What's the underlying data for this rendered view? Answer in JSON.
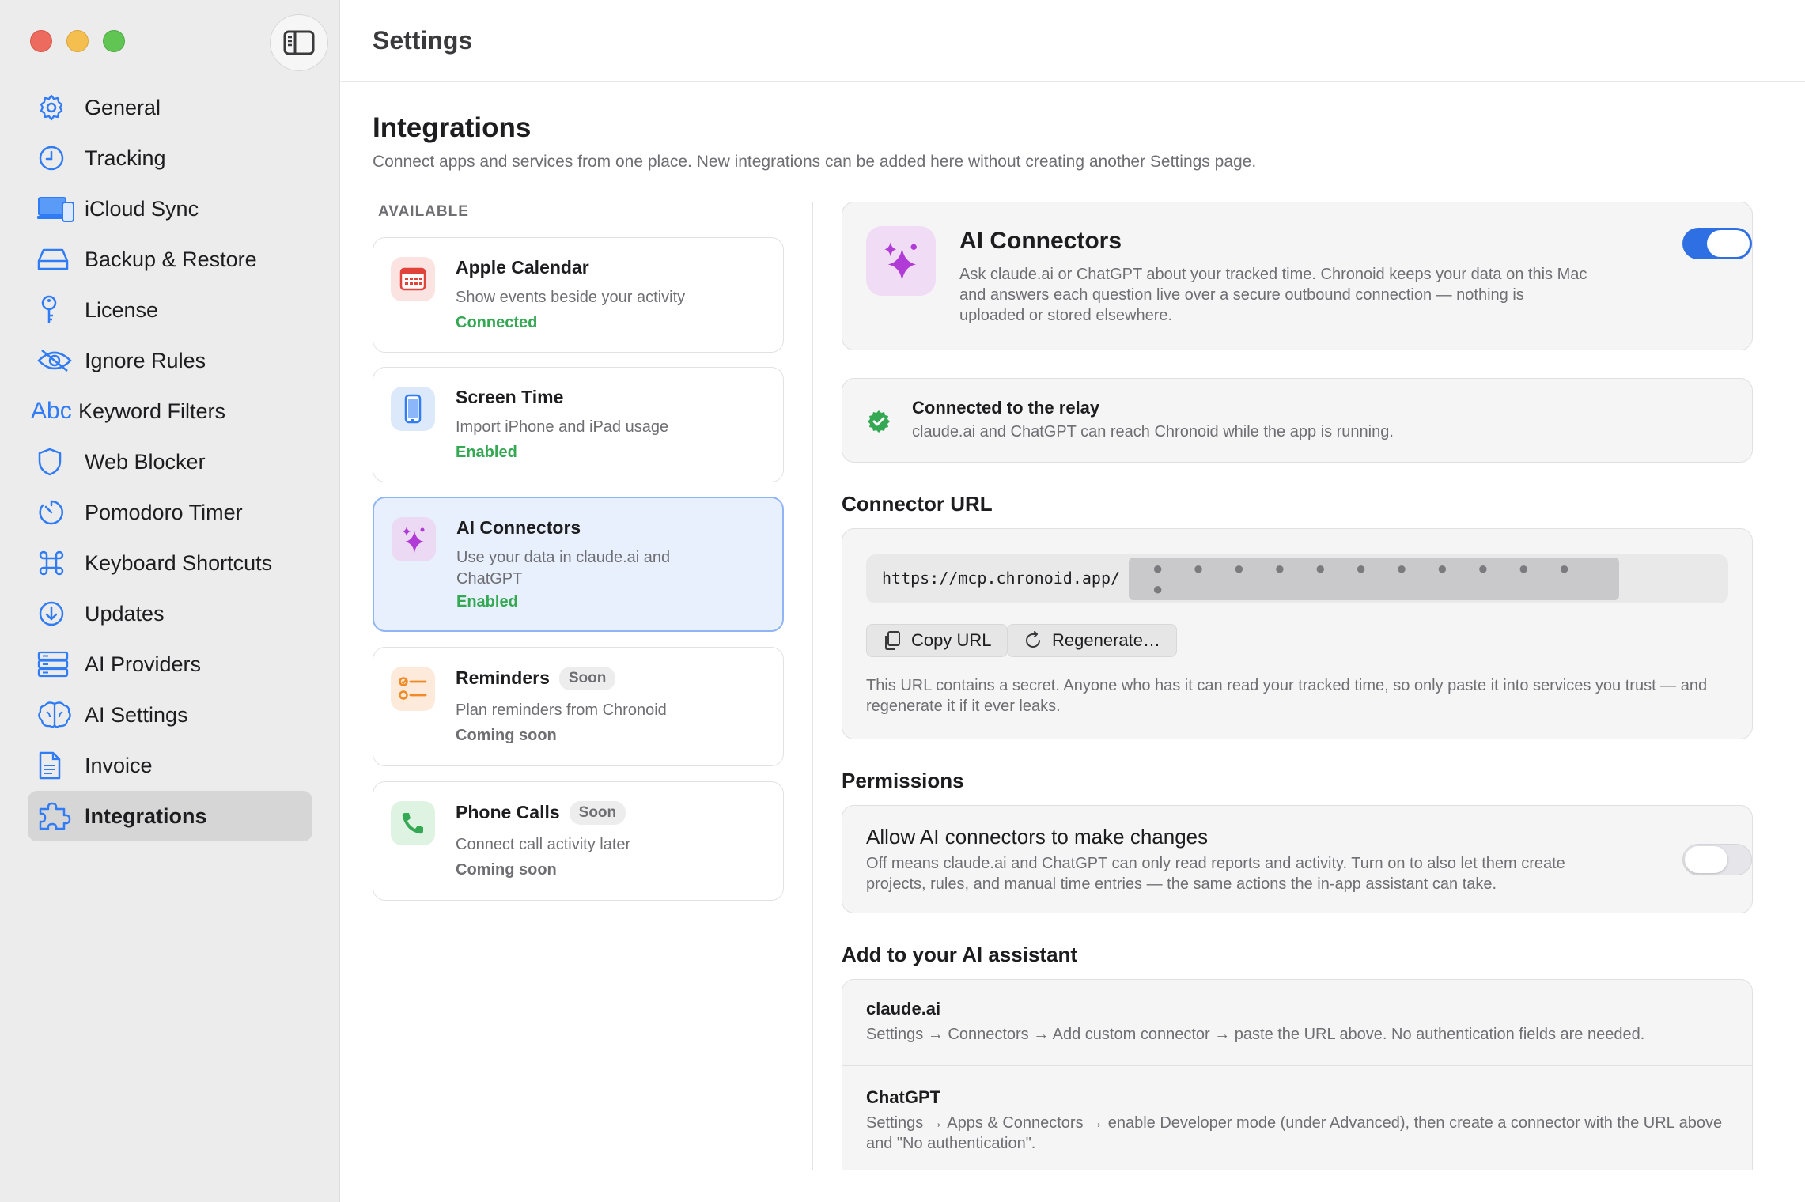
{
  "window": {
    "title": "Settings"
  },
  "sidebar": {
    "items": [
      {
        "label": "General",
        "icon": "gear-icon"
      },
      {
        "label": "Tracking",
        "icon": "clock-icon"
      },
      {
        "label": "iCloud Sync",
        "icon": "laptop-phone-icon"
      },
      {
        "label": "Backup & Restore",
        "icon": "drive-icon"
      },
      {
        "label": "License",
        "icon": "key-icon"
      },
      {
        "label": "Ignore Rules",
        "icon": "eye-slash-icon"
      },
      {
        "label": "Keyword Filters",
        "icon": "abc-icon",
        "icon_text": "Abc"
      },
      {
        "label": "Web Blocker",
        "icon": "shield-icon"
      },
      {
        "label": "Pomodoro Timer",
        "icon": "timer-icon"
      },
      {
        "label": "Keyboard Shortcuts",
        "icon": "command-icon"
      },
      {
        "label": "Updates",
        "icon": "download-icon"
      },
      {
        "label": "AI Providers",
        "icon": "server-icon"
      },
      {
        "label": "AI Settings",
        "icon": "brain-icon"
      },
      {
        "label": "Invoice",
        "icon": "document-icon"
      },
      {
        "label": "Integrations",
        "icon": "puzzle-icon",
        "active": true
      }
    ]
  },
  "integrations": {
    "title": "Integrations",
    "subtitle": "Connect apps and services from one place. New integrations can be added here without creating another Settings page.",
    "available_label": "AVAILABLE",
    "cards": [
      {
        "name": "Apple Calendar",
        "desc": "Show events beside your activity",
        "status": "Connected",
        "icon": "calendar-icon"
      },
      {
        "name": "Screen Time",
        "desc": "Import iPhone and iPad usage",
        "status": "Enabled",
        "icon": "phone-device-icon"
      },
      {
        "name": "AI Connectors",
        "desc": "Use your data in claude.ai and ChatGPT",
        "status": "Enabled",
        "icon": "sparkles-icon",
        "selected": true
      },
      {
        "name": "Reminders",
        "badge": "Soon",
        "desc": "Plan reminders from Chronoid",
        "status": "Coming soon",
        "icon": "checklist-icon"
      },
      {
        "name": "Phone Calls",
        "badge": "Soon",
        "desc": "Connect call activity later",
        "status": "Coming soon",
        "icon": "phone-icon"
      }
    ]
  },
  "detail": {
    "header": {
      "title": "AI Connectors",
      "desc": "Ask claude.ai or ChatGPT about your tracked time. Chronoid keeps your data on this Mac and answers each question live over a secure outbound connection — nothing is uploaded or stored elsewhere.",
      "enabled": true
    },
    "relay": {
      "title": "Connected to the relay",
      "desc": "claude.ai and ChatGPT can reach Chronoid while the app is running."
    },
    "connector_url": {
      "heading": "Connector URL",
      "url_prefix": "https://mcp.chronoid.app/",
      "mask": "● ● ● ● ● ● ● ● ● ● ● ●",
      "copy_label": "Copy URL",
      "regen_label": "Regenerate…",
      "note": "This URL contains a secret. Anyone who has it can read your tracked time, so only paste it into services you trust — and regenerate it if it ever leaks."
    },
    "permissions": {
      "heading": "Permissions",
      "title": "Allow AI connectors to make changes",
      "desc": "Off means claude.ai and ChatGPT can only read reports and activity. Turn on to also let them create projects, rules, and manual time entries — the same actions the in-app assistant can take.",
      "enabled": false
    },
    "assistants": {
      "heading": "Add to your AI assistant",
      "items": [
        {
          "name": "claude.ai",
          "desc": "Settings → Connectors → Add custom connector → paste the URL above. No authentication fields are needed."
        },
        {
          "name": "ChatGPT",
          "desc": "Settings → Apps & Connectors → enable Developer mode (under Advanced), then create a connector with the URL above and \"No authentication\"."
        }
      ]
    }
  },
  "colors": {
    "accent": "#2f6fe4",
    "green": "#34a853",
    "sidebar_bg": "#ececec"
  }
}
